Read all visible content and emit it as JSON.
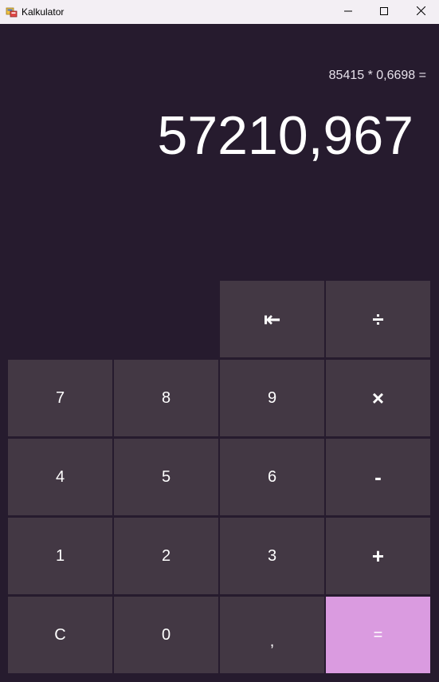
{
  "window": {
    "title": "Kalkulator"
  },
  "display": {
    "expression": "85415 * 0,6698 =",
    "result": "57210,967"
  },
  "keys": {
    "backspace": "⇤",
    "divide": "÷",
    "seven": "7",
    "eight": "8",
    "nine": "9",
    "multiply": "×",
    "four": "4",
    "five": "5",
    "six": "6",
    "minus": "-",
    "one": "1",
    "two": "2",
    "three": "3",
    "plus": "+",
    "clear": "C",
    "zero": "0",
    "comma": ",",
    "equals": "="
  },
  "colors": {
    "background": "#261b2e",
    "key": "#433844",
    "equals_key": "#da9be0",
    "titlebar": "#f3eff4"
  },
  "icons": {
    "app": "calculator-app-icon",
    "minimize": "minimize-icon",
    "maximize": "maximize-icon",
    "close": "close-icon"
  }
}
